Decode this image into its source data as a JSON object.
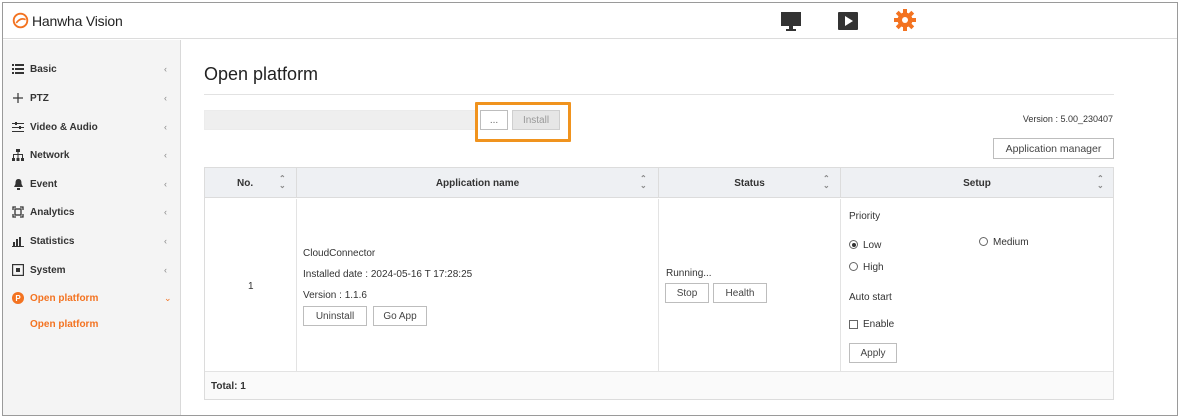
{
  "header": {
    "brand": "Hanwha Vision",
    "brand_color": "#f37321",
    "icons": [
      "monitor-icon",
      "play-icon",
      "gear-icon"
    ]
  },
  "sidebar": {
    "items": [
      {
        "label": "Basic",
        "icon": "list-icon"
      },
      {
        "label": "PTZ",
        "icon": "move-arrows-icon"
      },
      {
        "label": "Video & Audio",
        "icon": "sliders-icon"
      },
      {
        "label": "Network",
        "icon": "network-icon"
      },
      {
        "label": "Event",
        "icon": "bell-icon"
      },
      {
        "label": "Analytics",
        "icon": "frame-icon"
      },
      {
        "label": "Statistics",
        "icon": "bar-chart-icon"
      },
      {
        "label": "System",
        "icon": "system-icon"
      },
      {
        "label": "Open platform",
        "icon": "open-platform-icon",
        "active": true
      }
    ],
    "collapsed_chevron": "‹",
    "expanded_chevron": "⌄",
    "subitem": "Open platform"
  },
  "main": {
    "title": "Open platform",
    "browse_label": "...",
    "install_label": "Install",
    "version": "Version : 5.00_230407",
    "app_manager_label": "Application manager",
    "table": {
      "headers": [
        "No.",
        "Application name",
        "Status",
        "Setup"
      ],
      "row": {
        "no": "1",
        "app_name": "CloudConnector",
        "installed_date": "Installed date : 2024-05-16 T 17:28:25",
        "version": "Version : 1.1.6",
        "uninstall_label": "Uninstall",
        "goapp_label": "Go App",
        "status": "Running...",
        "stop_label": "Stop",
        "health_label": "Health",
        "priority_label": "Priority",
        "priority_options": [
          "Low",
          "Medium",
          "High"
        ],
        "priority_selected": "Low",
        "autostart_label": "Auto start",
        "enable_label": "Enable",
        "enable_checked": false,
        "apply_label": "Apply"
      },
      "total": "Total: 1"
    }
  }
}
